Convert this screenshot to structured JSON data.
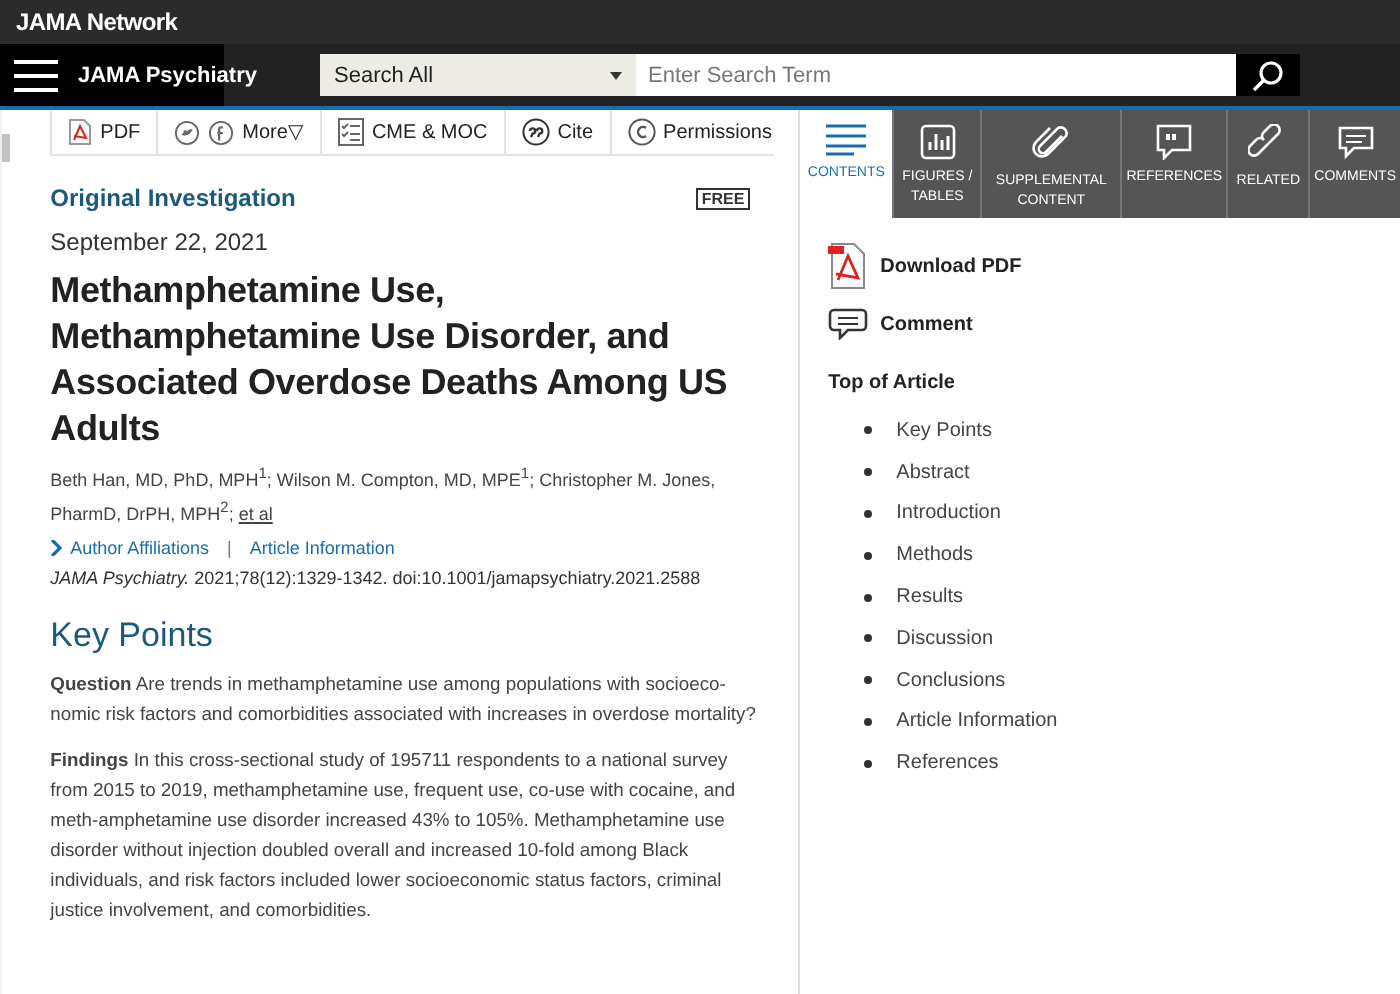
{
  "header": {
    "network": "JAMA Network",
    "journal": "JAMA Psychiatry",
    "search": {
      "scope": "Search All",
      "placeholder": "Enter Search Term"
    }
  },
  "toolbar": [
    {
      "kind": "pdf",
      "label": "PDF"
    },
    {
      "kind": "share",
      "label": "More▽"
    },
    {
      "kind": "cme",
      "label": "CME & MOC"
    },
    {
      "kind": "cite",
      "label": "Cite"
    },
    {
      "kind": "permissions",
      "label": "Permissions"
    }
  ],
  "tabs": [
    {
      "kind": "contents",
      "label": "CONTENTS",
      "selected": true
    },
    {
      "kind": "figures",
      "label": "FIGURES / TABLES",
      "selected": false
    },
    {
      "kind": "supplemental",
      "label": "SUPPLEMENTAL CONTENT",
      "selected": false
    },
    {
      "kind": "references",
      "label": "REFERENCES",
      "selected": false
    },
    {
      "kind": "related",
      "label": "RELATED",
      "selected": false
    },
    {
      "kind": "comments",
      "label": "COMMENTS",
      "selected": false
    }
  ],
  "article": {
    "type": "Original Investigation",
    "access": "FREE",
    "date": "September 22, 2021",
    "title": "Methamphetamine Use, Methamphetamine Use Disorder, and Associated Overdose Deaths Among US Adults",
    "authors": "Beth Han, MD, PhD, MPH$^{1}$; Wilson M. Compton, MD, MPE$^{1}$; Christopher M. Jones, PharmD, DrPH, MPH$^{2}$;",
    "authors_more": "et al",
    "links": [
      "Author Affiliations",
      "Article Information"
    ],
    "separator": "|",
    "citation": "*JAMA Psychiatry.* 2021;78(12):1329-1342. doi:10.1001/jamapsychiatry.2021.2588"
  },
  "key_points": {
    "heading": "Key Points",
    "paragraphs": [
      "**Question** Are trends in methamphetamine use among populations with socioeco-nomic risk factors and comorbidities associated with increases in overdose mortality?",
      "**Findings** In this cross-sectional study of 195711 respondents to a national survey from 2015 to 2019, methamphetamine use, frequent use, co-use with cocaine, and meth-amphetamine use disorder increased 43% to 105%. Methamphetamine use disorder without injection doubled overall and increased 10-fold among Black individuals, and risk factors included lower socioeconomic status factors, criminal justice involvement, and comorbidities."
    ]
  },
  "sidebar": {
    "actions": [
      {
        "kind": "pdf",
        "label": "Download PDF"
      },
      {
        "kind": "comment",
        "label": "Comment"
      }
    ],
    "toc_heading": "Top of Article",
    "toc": [
      "Key Points",
      "Abstract",
      "Introduction",
      "Methods",
      "Results",
      "Discussion",
      "Conclusions",
      "Article Information",
      "References"
    ]
  }
}
